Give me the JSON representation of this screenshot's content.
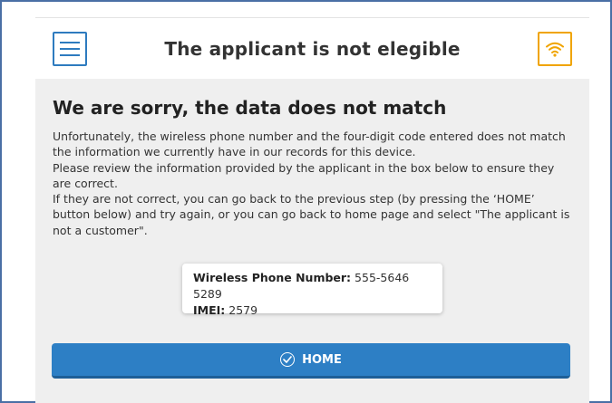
{
  "header": {
    "title": "The applicant is not elegible",
    "menu_icon": "hamburger-menu-icon",
    "wifi_icon": "wifi-icon",
    "accent_blue": "#2e7bbf",
    "accent_orange": "#f0a400"
  },
  "main": {
    "heading": "We are sorry, the data does not match",
    "paragraphs": [
      "Unfortunately, the wireless phone number and the four-digit code entered does not match the information we currently have in our records for this device.",
      "Please review the information provided by the applicant in the box below to ensure they are correct.",
      "If they are not correct, you can go back to the previous step (by pressing the ‘HOME’ button below) and try again, or you can go back to home page and select \"The applicant is not a customer\"."
    ],
    "info": {
      "phone_label": "Wireless Phone Number:",
      "phone_value": "555-5646 5289",
      "imei_label": "IMEI:",
      "imei_value": "2579"
    },
    "home_button": {
      "label": "HOME",
      "icon": "check-circle-icon",
      "color": "#2d7fc5"
    }
  }
}
